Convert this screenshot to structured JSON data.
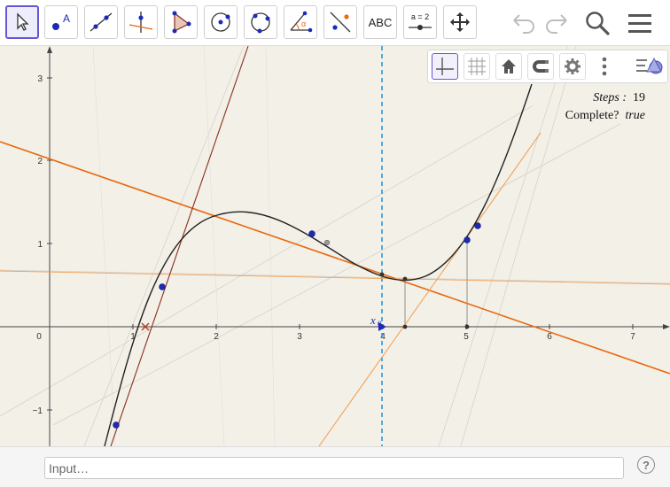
{
  "toolbar": {
    "tools": [
      {
        "name": "move"
      },
      {
        "name": "point",
        "label": "A"
      },
      {
        "name": "line"
      },
      {
        "name": "perpendicular-line"
      },
      {
        "name": "polygon"
      },
      {
        "name": "circle-center-point"
      },
      {
        "name": "circle-three-points"
      },
      {
        "name": "angle",
        "label": "α"
      },
      {
        "name": "reflect"
      },
      {
        "name": "text",
        "label": "ABC"
      },
      {
        "name": "slider",
        "label": "a = 2"
      },
      {
        "name": "move-graphics-view"
      }
    ]
  },
  "graphics": {
    "x_ticks": [
      "0",
      "1",
      "2",
      "3",
      "4",
      "5",
      "6",
      "7"
    ],
    "y_ticks": [
      "3",
      "2",
      "1",
      "−1"
    ],
    "x0_label": "x",
    "x0_sub": "0",
    "steps_label": "Steps :",
    "steps_value": "19",
    "complete_label": "Complete?",
    "complete_value": "true"
  },
  "colors": {
    "curve": "#222222",
    "tangent_main": "#e8690f",
    "tangent_light": "#f2a35a",
    "tangent_dark": "#8b2e1f",
    "point": "#1c2ab8",
    "dashed": "#1e8fd8",
    "background": "#f3f0e8"
  },
  "input": {
    "placeholder": "Input…"
  }
}
